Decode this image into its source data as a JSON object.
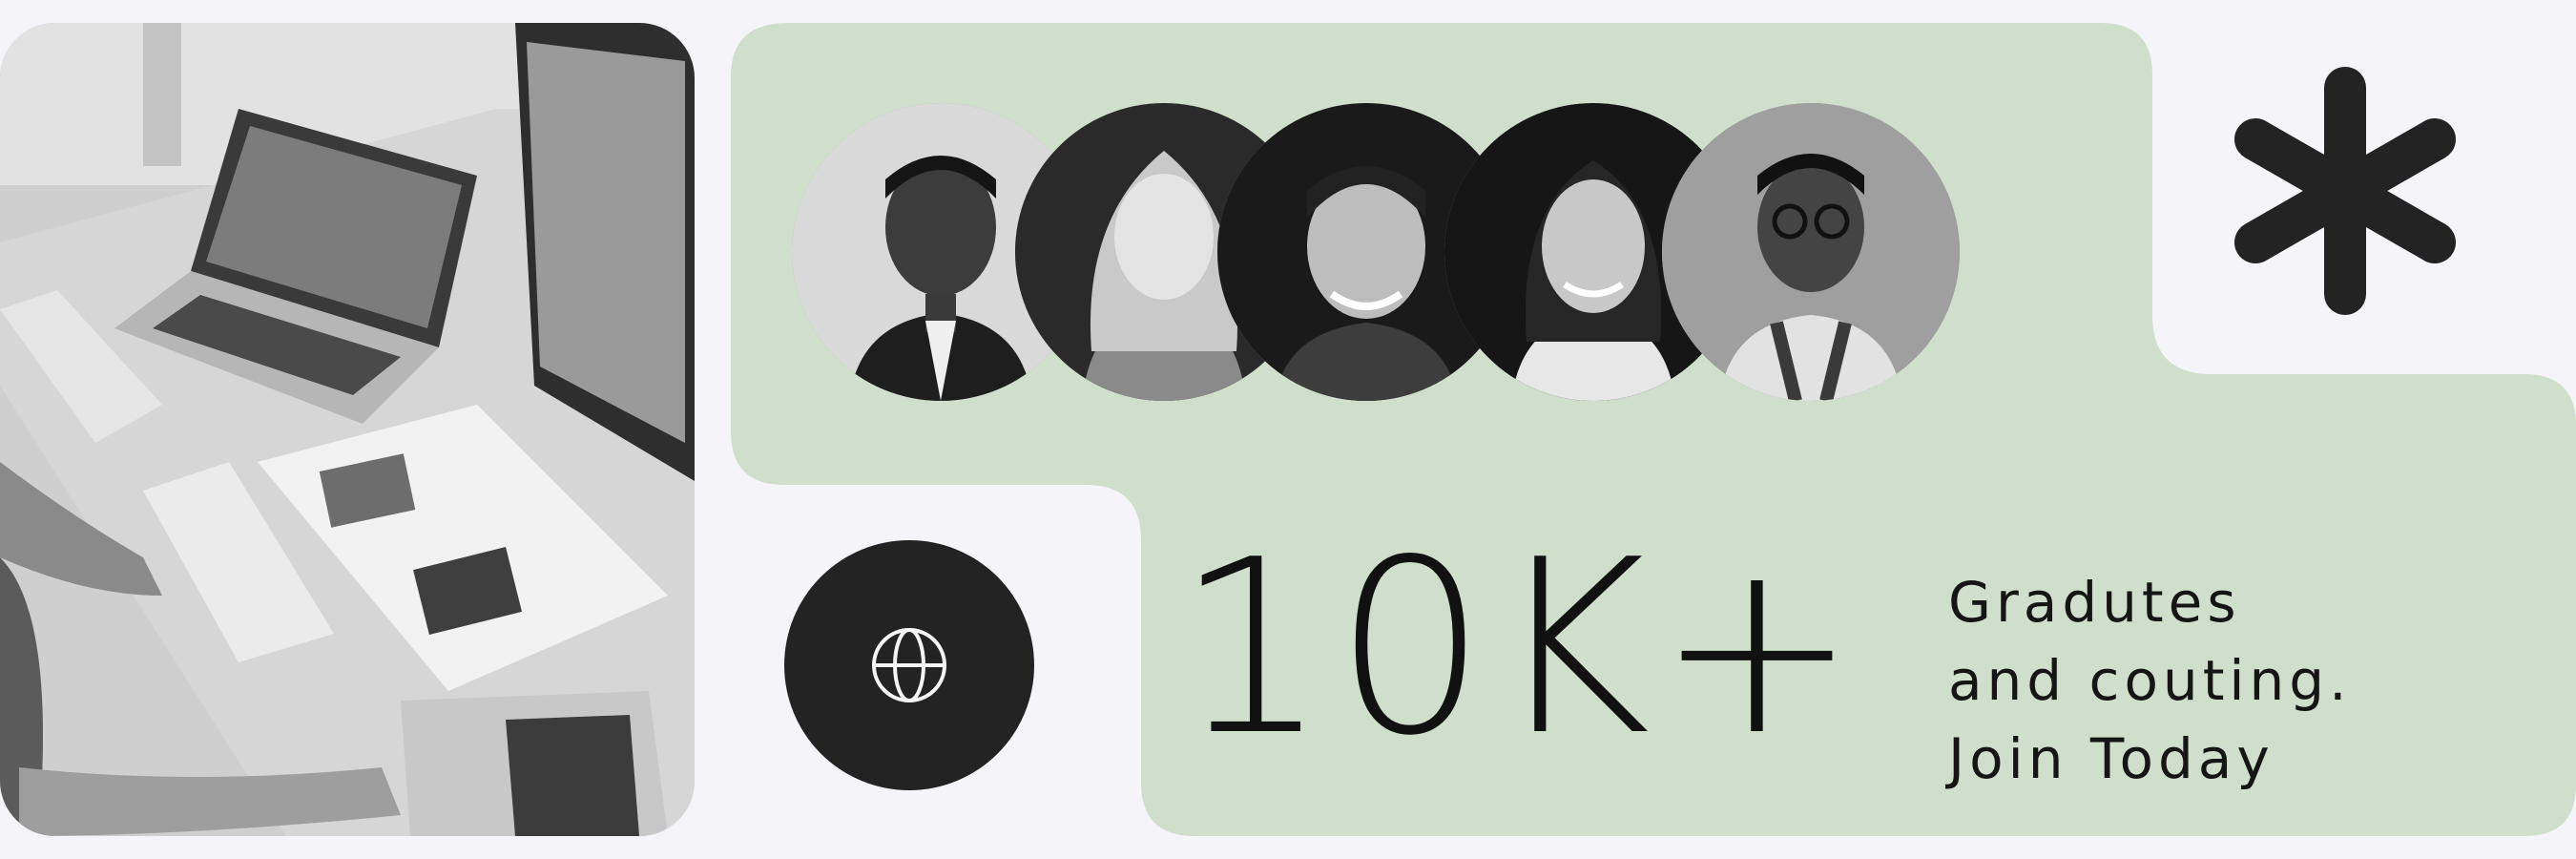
{
  "hero_photo": {
    "icon": "workspace-photo"
  },
  "graduates": [
    {
      "icon": "graduate-portrait-1"
    },
    {
      "icon": "graduate-portrait-2"
    },
    {
      "icon": "graduate-portrait-3"
    },
    {
      "icon": "graduate-portrait-4"
    },
    {
      "icon": "graduate-portrait-5"
    }
  ],
  "decor": {
    "icon": "asterisk-icon"
  },
  "globe": {
    "icon": "globe-icon"
  },
  "stat": {
    "number": "10K+",
    "caption_lines": [
      "Gradutes",
      "and couting.",
      "Join Today"
    ]
  },
  "colors": {
    "background": "#f5f4f9",
    "accent_green": "#d0dfcb",
    "dark": "#232323",
    "text": "#111111"
  }
}
